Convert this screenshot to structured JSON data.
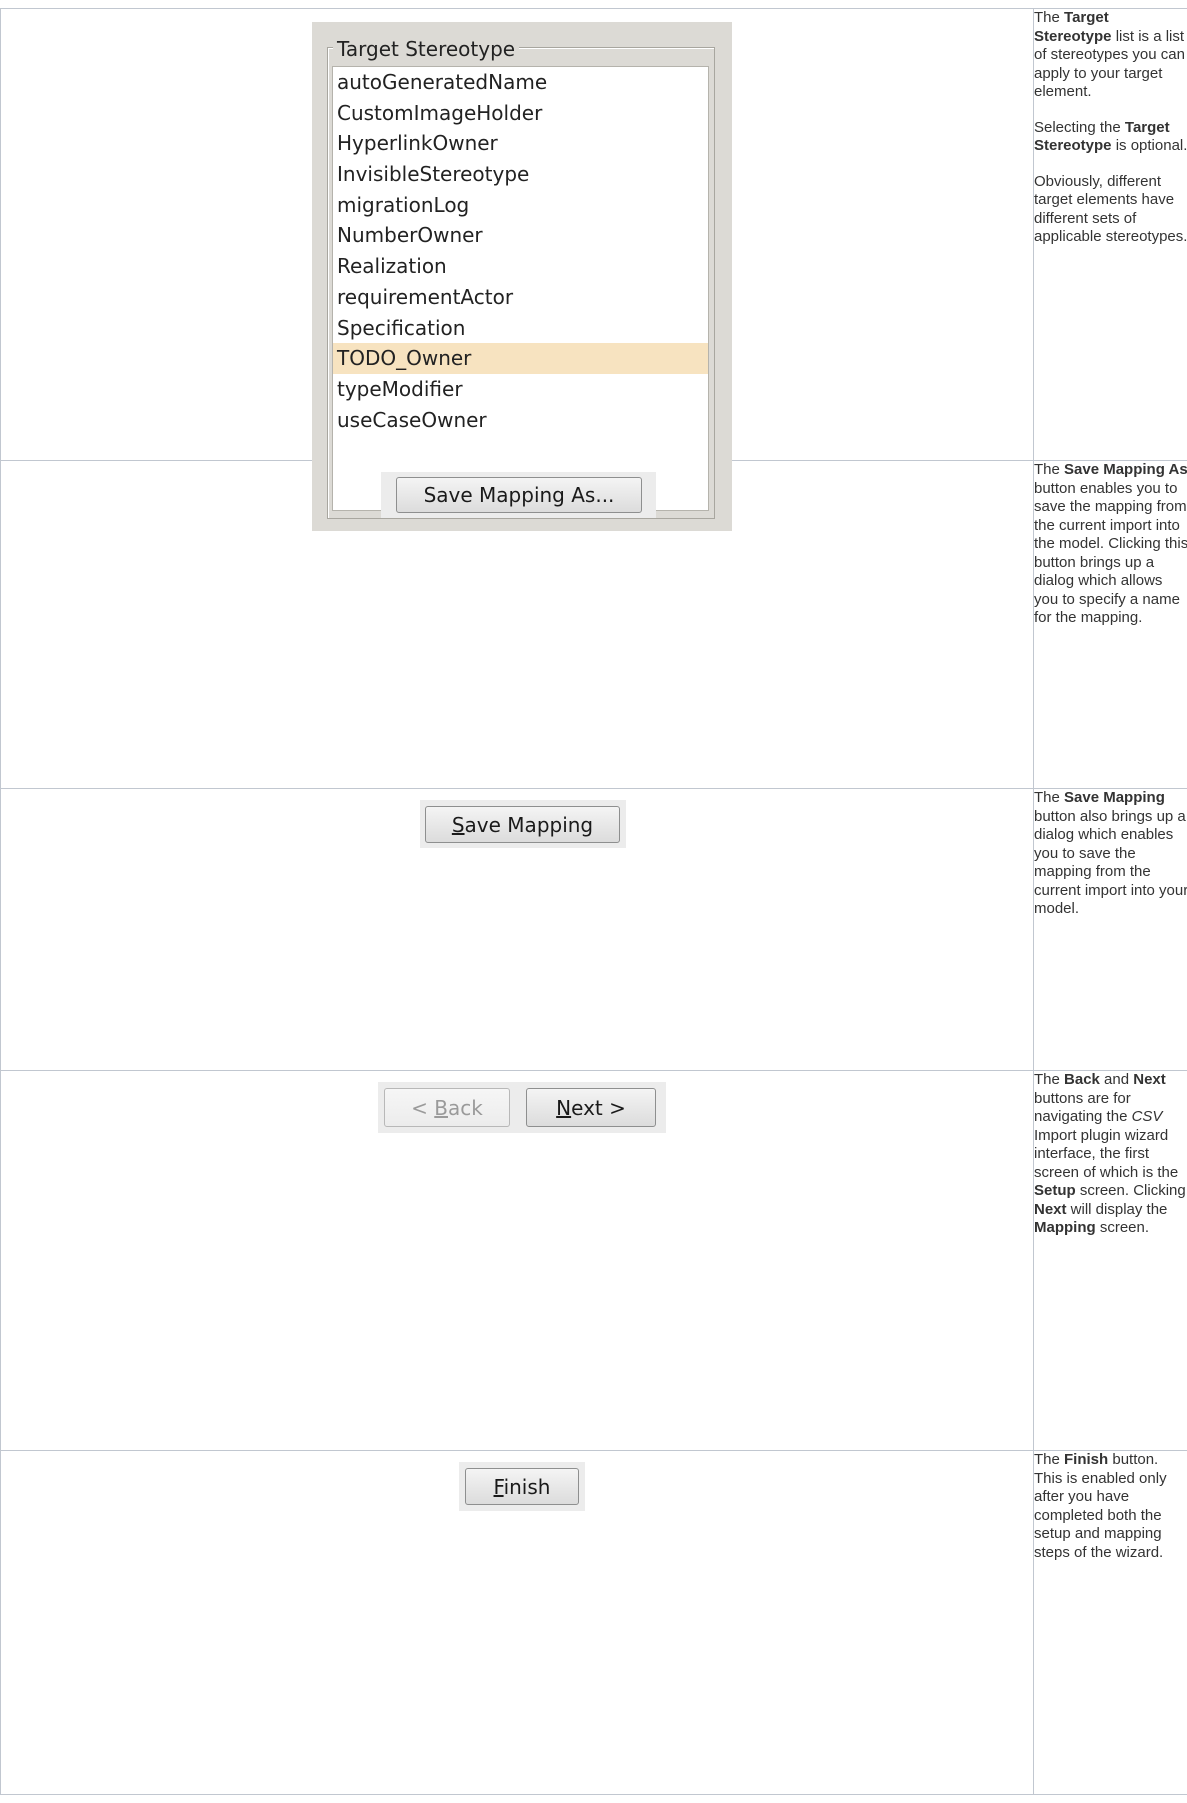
{
  "stereotype_panel": {
    "title": "Target Stereotype",
    "items": [
      "autoGeneratedName",
      "CustomImageHolder",
      "HyperlinkOwner",
      "InvisibleStereotype",
      "migrationLog",
      "NumberOwner",
      "Realization",
      "requirementActor",
      "Specification",
      "TODO_Owner",
      "typeModifier",
      "useCaseOwner"
    ],
    "selected": "TODO_Owner",
    "selected_color": "#f7e3c0"
  },
  "buttons": {
    "save_as": "Save Mapping As...",
    "save_mapping_mnemonic": "S",
    "save_mapping_rest": "ave Mapping",
    "back_prefix": "< ",
    "back_mnemonic": "B",
    "back_rest": "ack",
    "next_mnemonic": "N",
    "next_rest": "ext >",
    "finish_mnemonic": "F",
    "finish_rest": "inish"
  },
  "descriptions": {
    "row1": {
      "p1": [
        "The ",
        "Target Stereotype",
        " list is a list of stereotypes you can apply to your target element."
      ],
      "p2": [
        "Selecting the ",
        "Target Stereotype",
        " is optional."
      ],
      "p3": "Obviously, different target elements have different sets of applicable stereotypes."
    },
    "row2": [
      "The ",
      "Save Mapping As",
      " button enables you to save the mapping from the current import into the model. Clicking this button brings up a dialog which allows you to specify a name for the mapping."
    ],
    "row3": [
      "The ",
      "Save Mapping",
      " button also brings up a dialog which enables you to save the mapping from the current import into your model."
    ],
    "row4": {
      "a": "The ",
      "back": "Back",
      "b": " and ",
      "next": "Next",
      "c": " buttons are for navigating the ",
      "csv": "CSV",
      "d": " Import plugin wizard interface, the first screen of which is the ",
      "setup": "Setup",
      "e": " screen. Clicking ",
      "next2": "Next",
      "f": " will display the ",
      "map": "Mapping",
      "g": " screen."
    },
    "row5": [
      "The ",
      "Finish",
      " button. This is enabled only after you have completed both the setup and mapping steps of the wizard."
    ]
  }
}
